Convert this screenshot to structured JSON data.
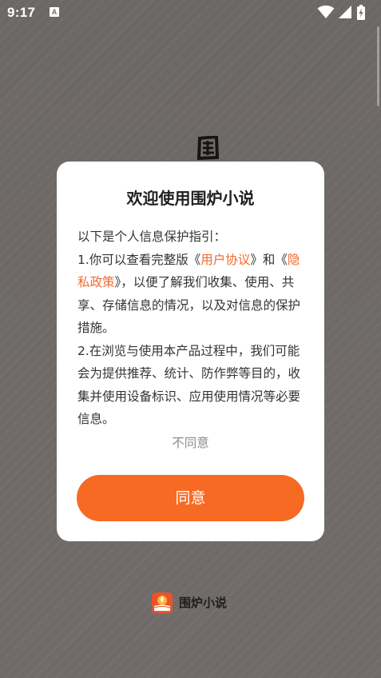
{
  "status_bar": {
    "time": "9:17",
    "notification_icon": "A",
    "icons": [
      "wifi-icon",
      "signal-icon",
      "battery-icon"
    ]
  },
  "dialog": {
    "title": "欢迎使用围炉小说",
    "intro": "以下是个人信息保护指引：",
    "p1_prefix": "1.你可以查看完整版《",
    "user_agreement_link": "用户协议",
    "p1_middle": "》和《",
    "privacy_policy_link": "隐私政策",
    "p1_suffix": "》，以便了解我们收集、使用、共享、存储信息的情况，以及对信息的保护措施。",
    "p2": "2.在浏览与使用本产品过程中，我们可能会为提供推荐、统计、防作弊等目的，收集并使用设备标识、应用使用情况等必要信息。",
    "disagree_label": "不同意",
    "agree_label": "同意"
  },
  "footer": {
    "app_name": "围炉小说"
  },
  "colors": {
    "accent": "#f66a24",
    "link": "#f26a2d",
    "background": "#6f6a68"
  }
}
